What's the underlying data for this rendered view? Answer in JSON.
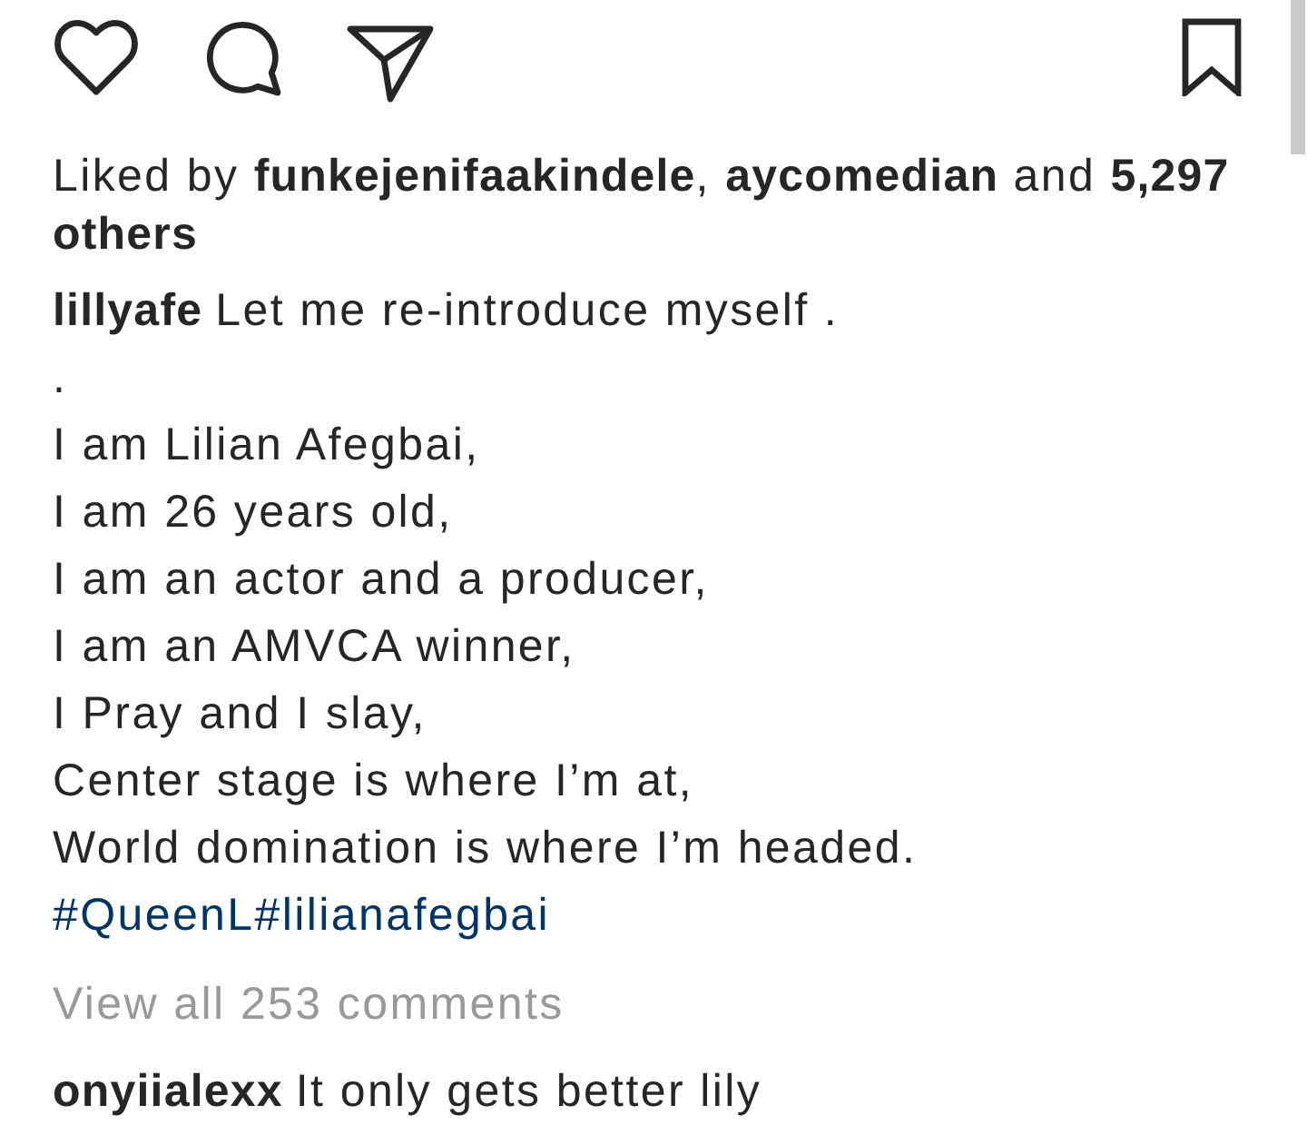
{
  "actions": {
    "liked": false,
    "saved": false
  },
  "likes": "Liked by **funkejenifaakindele**, **aycomedian** and **5,297 others**",
  "caption": {
    "username": "lillyafe",
    "lines": [
      "Let me re-introduce myself .",
      ".",
      "I am Lilian Afegbai,",
      "I am 26 years old,",
      "I am an actor and a producer,",
      "I am an AMVCA winner,",
      "I Pray and I slay,",
      "Center stage is where I’m at,",
      "World domination is where I’m headed."
    ],
    "hashtags": [
      "#QueenL",
      "#lilianafegbai"
    ]
  },
  "view_all_comments": "View all 253 comments",
  "comments": [
    {
      "username": "onyiialexx",
      "text": "It only gets better lily"
    }
  ]
}
